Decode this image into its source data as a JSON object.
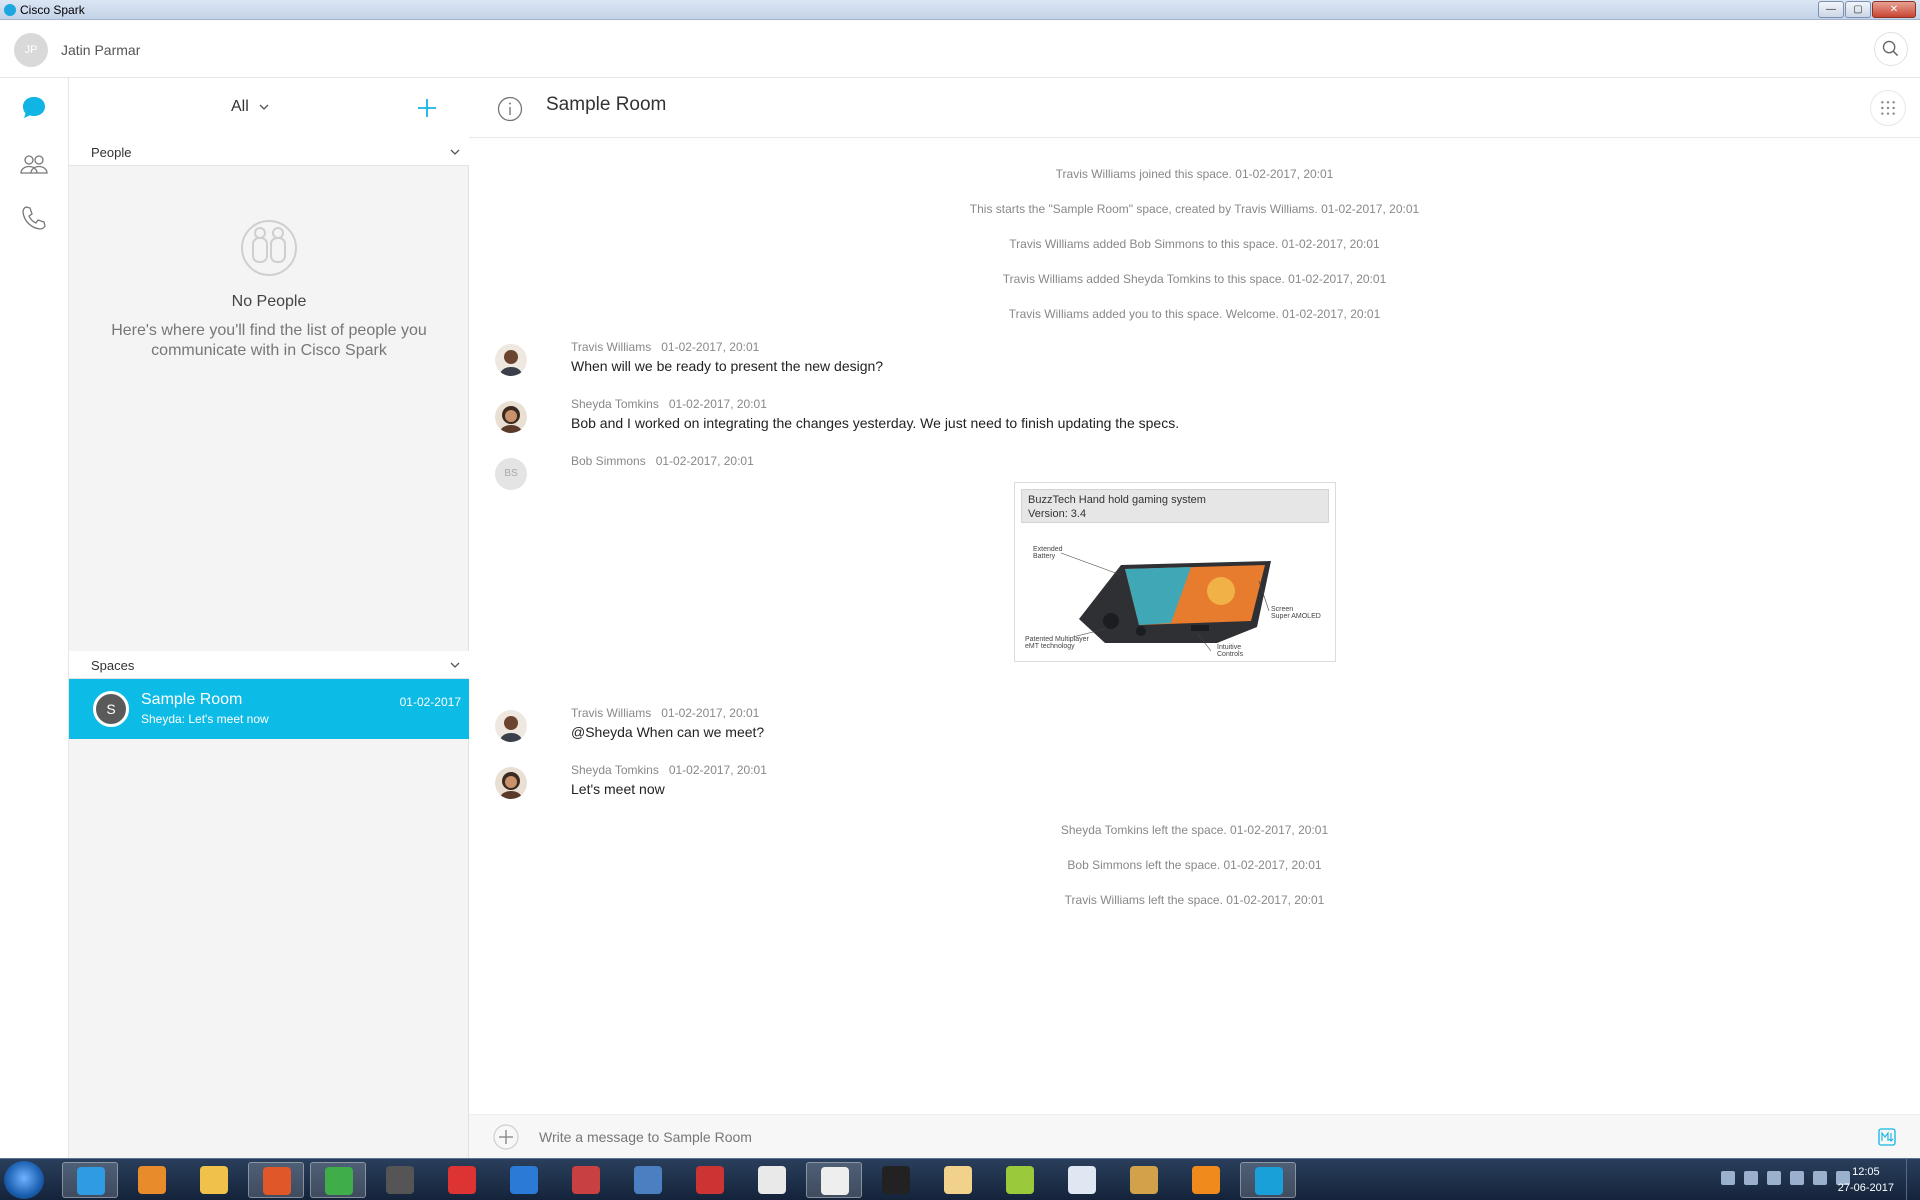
{
  "window": {
    "title": "Cisco Spark"
  },
  "user": {
    "initials": "JP",
    "name": "Jatin Parmar"
  },
  "list": {
    "filter_label": "All",
    "people_header": "People",
    "empty_title": "No People",
    "empty_text": "Here's where you'll find the list of people you communicate with in Cisco Spark",
    "spaces_header": "Spaces",
    "spaces": [
      {
        "initial": "S",
        "name": "Sample Room",
        "preview": "Sheyda: Let's meet now",
        "date": "01-02-2017"
      }
    ]
  },
  "conversation": {
    "title": "Sample Room",
    "system_top": [
      "Travis Williams joined this space. 01-02-2017, 20:01",
      "This starts the \"Sample Room\" space, created by Travis Williams. 01-02-2017, 20:01",
      "Travis Williams added Bob Simmons to this space. 01-02-2017, 20:01",
      "Travis Williams added Sheyda Tomkins to this space. 01-02-2017, 20:01",
      "Travis Williams added you to this space. Welcome. 01-02-2017, 20:01"
    ],
    "messages": [
      {
        "author": "Travis Williams",
        "time": "01-02-2017, 20:01",
        "text": "When will we be ready to present the new design?"
      },
      {
        "author": "Sheyda Tomkins",
        "time": "01-02-2017, 20:01",
        "text": "Bob and I worked on integrating the changes yesterday. We just need to finish updating the specs."
      },
      {
        "author": "Bob Simmons",
        "initials": "BS",
        "time": "01-02-2017, 20:01",
        "text": ""
      },
      {
        "author": "Travis Williams",
        "time": "01-02-2017, 20:01",
        "text": "@Sheyda When can we meet?"
      },
      {
        "author": "Sheyda Tomkins",
        "time": "01-02-2017, 20:01",
        "text": "Let's meet now"
      }
    ],
    "attachment": {
      "title": "BuzzTech Hand hold gaming system",
      "version": "Version: 3.4",
      "callouts": [
        "Extended",
        "Battery",
        "Screen",
        "Super AMOLED",
        "Patented Multiplayer",
        "eMT technology",
        "Intuitive",
        "Controls"
      ]
    },
    "system_bottom": [
      "Sheyda Tomkins left the space. 01-02-2017, 20:01",
      "Bob Simmons left the space. 01-02-2017, 20:01",
      "Travis Williams left the space. 01-02-2017, 20:01"
    ],
    "composer_placeholder": "Write a message to Sample Room"
  },
  "taskbar": {
    "apps": [
      "internet-explorer",
      "media-player",
      "file-explorer",
      "firefox",
      "chrome",
      "app-6",
      "app-7",
      "app-8",
      "app-9",
      "app-10",
      "app-11",
      "app-12",
      "app-13",
      "app-14",
      "app-15",
      "app-16",
      "app-17",
      "app-18",
      "app-19",
      "cisco-spark"
    ],
    "clock_time": "12:05",
    "clock_date": "27-06-2017"
  },
  "colors": {
    "accent": "#0cbbe6",
    "nav_active": "#11b5e4"
  }
}
